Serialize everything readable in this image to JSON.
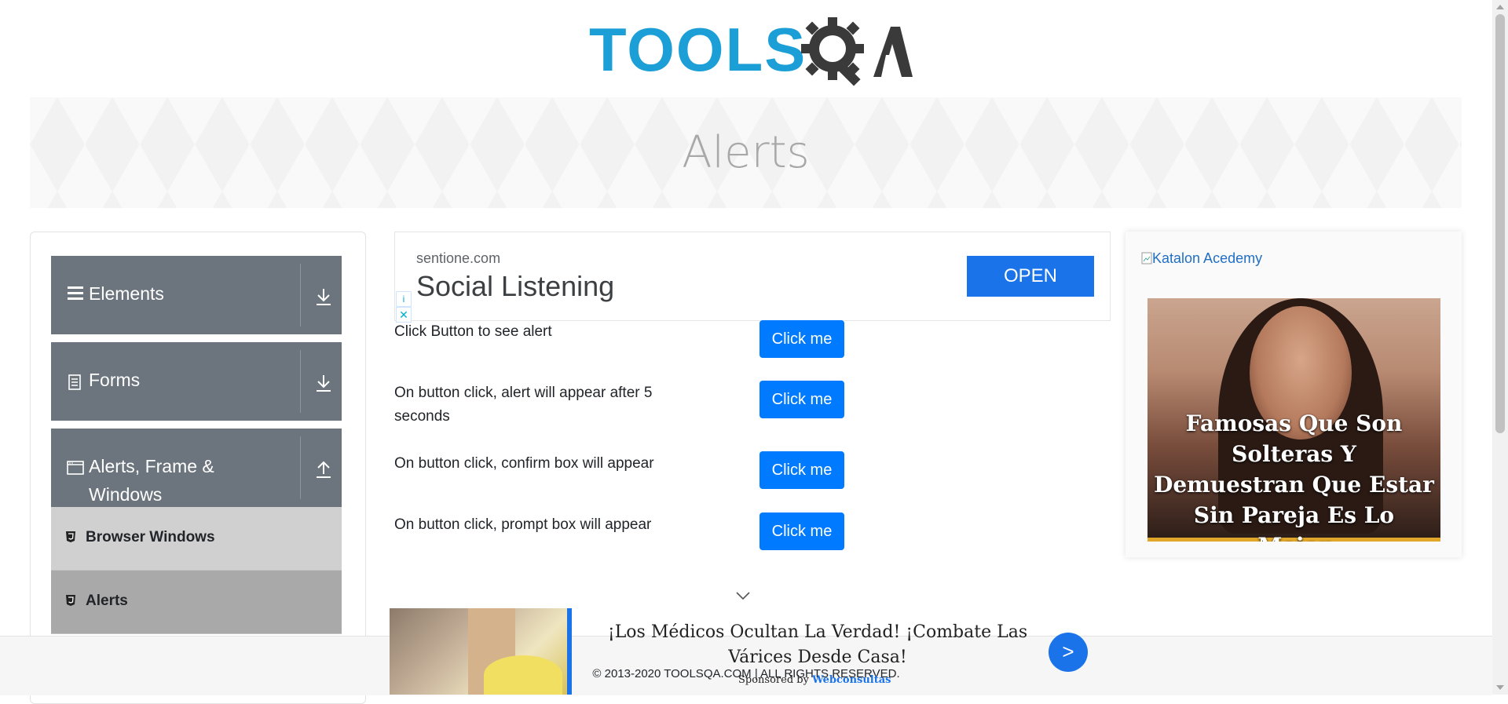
{
  "logo": {
    "tools": "TOOLS",
    "qa": "QA"
  },
  "banner": {
    "title": "Alerts"
  },
  "sidebar": {
    "groups": [
      {
        "label": "Elements",
        "icon": "menu-icon",
        "arrow": "download-arrow-icon"
      },
      {
        "label": "Forms",
        "icon": "form-icon",
        "arrow": "download-arrow-icon"
      },
      {
        "label": "Alerts, Frame & Windows",
        "icon": "window-icon",
        "arrow": "upload-arrow-icon"
      }
    ],
    "items": [
      {
        "label": "Browser Windows",
        "icon": "html5-icon"
      },
      {
        "label": "Alerts",
        "icon": "html5-icon"
      }
    ]
  },
  "ad_top": {
    "domain": "sentione.com",
    "headline": "Social Listening",
    "button": "OPEN",
    "info": "i",
    "close": "✕"
  },
  "alerts": [
    {
      "label": "Click Button to see alert",
      "button": "Click me"
    },
    {
      "label": "On button click, alert will appear after 5 seconds",
      "button": "Click me"
    },
    {
      "label": "On button click, confirm box will appear",
      "button": "Click me"
    },
    {
      "label": "On button click, prompt box will appear",
      "button": "Click me"
    }
  ],
  "right_ad": {
    "link_text": "Katalon Acedemy",
    "caption": "Famosas Que Son Solteras Y Demuestran Que Estar Sin Pareja Es Lo Mejor"
  },
  "bottom_ad": {
    "text": "¡Los Médicos Ocultan La Verdad! ¡Combate Las Várices Desde Casa!",
    "button": ">",
    "sponsored_prefix": "Sponsored by",
    "sponsor": "Webconsultas"
  },
  "footer": {
    "text": "© 2013-2020 TOOLSQA.COM | ALL RIGHTS RESERVED."
  },
  "colors": {
    "brand_blue": "#1c9fd6",
    "logo_dark": "#3a3a3a",
    "button_blue": "#007bff",
    "group_gray": "#6c757d"
  }
}
